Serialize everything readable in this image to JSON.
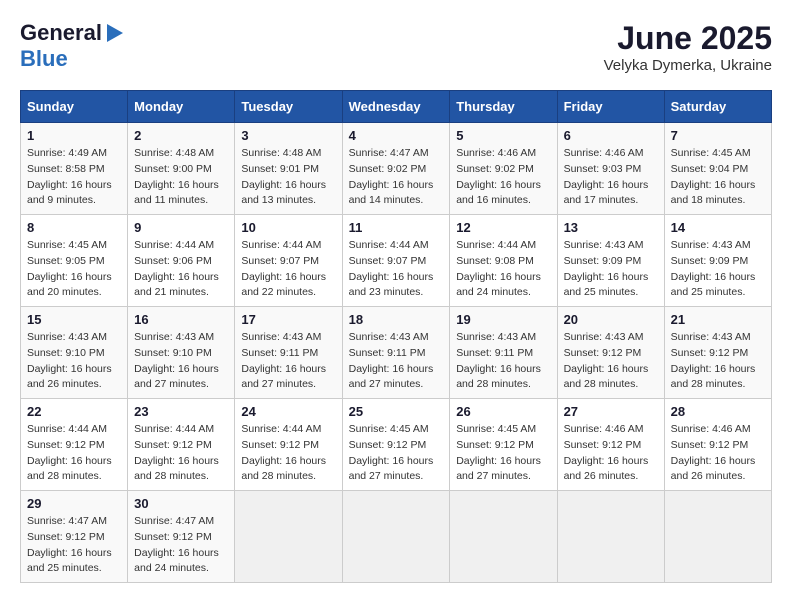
{
  "header": {
    "logo_general": "General",
    "logo_blue": "Blue",
    "month_title": "June 2025",
    "location": "Velyka Dymerka, Ukraine"
  },
  "calendar": {
    "days_of_week": [
      "Sunday",
      "Monday",
      "Tuesday",
      "Wednesday",
      "Thursday",
      "Friday",
      "Saturday"
    ],
    "weeks": [
      [
        {
          "day": null
        },
        {
          "day": "2",
          "sunrise": "4:48 AM",
          "sunset": "9:00 PM",
          "daylight": "16 hours and 11 minutes."
        },
        {
          "day": "3",
          "sunrise": "4:48 AM",
          "sunset": "9:01 PM",
          "daylight": "16 hours and 13 minutes."
        },
        {
          "day": "4",
          "sunrise": "4:47 AM",
          "sunset": "9:02 PM",
          "daylight": "16 hours and 14 minutes."
        },
        {
          "day": "5",
          "sunrise": "4:46 AM",
          "sunset": "9:02 PM",
          "daylight": "16 hours and 16 minutes."
        },
        {
          "day": "6",
          "sunrise": "4:46 AM",
          "sunset": "9:03 PM",
          "daylight": "16 hours and 17 minutes."
        },
        {
          "day": "7",
          "sunrise": "4:45 AM",
          "sunset": "9:04 PM",
          "daylight": "16 hours and 18 minutes."
        }
      ],
      [
        {
          "day": "8",
          "sunrise": "4:45 AM",
          "sunset": "9:05 PM",
          "daylight": "16 hours and 20 minutes."
        },
        {
          "day": "9",
          "sunrise": "4:44 AM",
          "sunset": "9:06 PM",
          "daylight": "16 hours and 21 minutes."
        },
        {
          "day": "10",
          "sunrise": "4:44 AM",
          "sunset": "9:07 PM",
          "daylight": "16 hours and 22 minutes."
        },
        {
          "day": "11",
          "sunrise": "4:44 AM",
          "sunset": "9:07 PM",
          "daylight": "16 hours and 23 minutes."
        },
        {
          "day": "12",
          "sunrise": "4:44 AM",
          "sunset": "9:08 PM",
          "daylight": "16 hours and 24 minutes."
        },
        {
          "day": "13",
          "sunrise": "4:43 AM",
          "sunset": "9:09 PM",
          "daylight": "16 hours and 25 minutes."
        },
        {
          "day": "14",
          "sunrise": "4:43 AM",
          "sunset": "9:09 PM",
          "daylight": "16 hours and 25 minutes."
        }
      ],
      [
        {
          "day": "15",
          "sunrise": "4:43 AM",
          "sunset": "9:10 PM",
          "daylight": "16 hours and 26 minutes."
        },
        {
          "day": "16",
          "sunrise": "4:43 AM",
          "sunset": "9:10 PM",
          "daylight": "16 hours and 27 minutes."
        },
        {
          "day": "17",
          "sunrise": "4:43 AM",
          "sunset": "9:11 PM",
          "daylight": "16 hours and 27 minutes."
        },
        {
          "day": "18",
          "sunrise": "4:43 AM",
          "sunset": "9:11 PM",
          "daylight": "16 hours and 27 minutes."
        },
        {
          "day": "19",
          "sunrise": "4:43 AM",
          "sunset": "9:11 PM",
          "daylight": "16 hours and 28 minutes."
        },
        {
          "day": "20",
          "sunrise": "4:43 AM",
          "sunset": "9:12 PM",
          "daylight": "16 hours and 28 minutes."
        },
        {
          "day": "21",
          "sunrise": "4:43 AM",
          "sunset": "9:12 PM",
          "daylight": "16 hours and 28 minutes."
        }
      ],
      [
        {
          "day": "22",
          "sunrise": "4:44 AM",
          "sunset": "9:12 PM",
          "daylight": "16 hours and 28 minutes."
        },
        {
          "day": "23",
          "sunrise": "4:44 AM",
          "sunset": "9:12 PM",
          "daylight": "16 hours and 28 minutes."
        },
        {
          "day": "24",
          "sunrise": "4:44 AM",
          "sunset": "9:12 PM",
          "daylight": "16 hours and 28 minutes."
        },
        {
          "day": "25",
          "sunrise": "4:45 AM",
          "sunset": "9:12 PM",
          "daylight": "16 hours and 27 minutes."
        },
        {
          "day": "26",
          "sunrise": "4:45 AM",
          "sunset": "9:12 PM",
          "daylight": "16 hours and 27 minutes."
        },
        {
          "day": "27",
          "sunrise": "4:46 AM",
          "sunset": "9:12 PM",
          "daylight": "16 hours and 26 minutes."
        },
        {
          "day": "28",
          "sunrise": "4:46 AM",
          "sunset": "9:12 PM",
          "daylight": "16 hours and 26 minutes."
        }
      ],
      [
        {
          "day": "29",
          "sunrise": "4:47 AM",
          "sunset": "9:12 PM",
          "daylight": "16 hours and 25 minutes."
        },
        {
          "day": "30",
          "sunrise": "4:47 AM",
          "sunset": "9:12 PM",
          "daylight": "16 hours and 24 minutes."
        },
        {
          "day": null
        },
        {
          "day": null
        },
        {
          "day": null
        },
        {
          "day": null
        },
        {
          "day": null
        }
      ]
    ],
    "week1_sunday": {
      "day": "1",
      "sunrise": "4:49 AM",
      "sunset": "8:58 PM",
      "daylight": "16 hours and 9 minutes."
    }
  }
}
